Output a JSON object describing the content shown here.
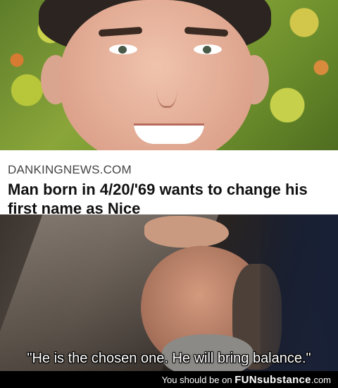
{
  "headline": {
    "site": "DANKINGNEWS.COM",
    "title": "Man born in 4/20/'69 wants to change his first name as Nice"
  },
  "caption": {
    "quote": "\"He is the chosen one. He will bring balance.\""
  },
  "footer": {
    "prefix": "You should be on",
    "logo": "FUNsubstance",
    "suffix": ".com"
  }
}
